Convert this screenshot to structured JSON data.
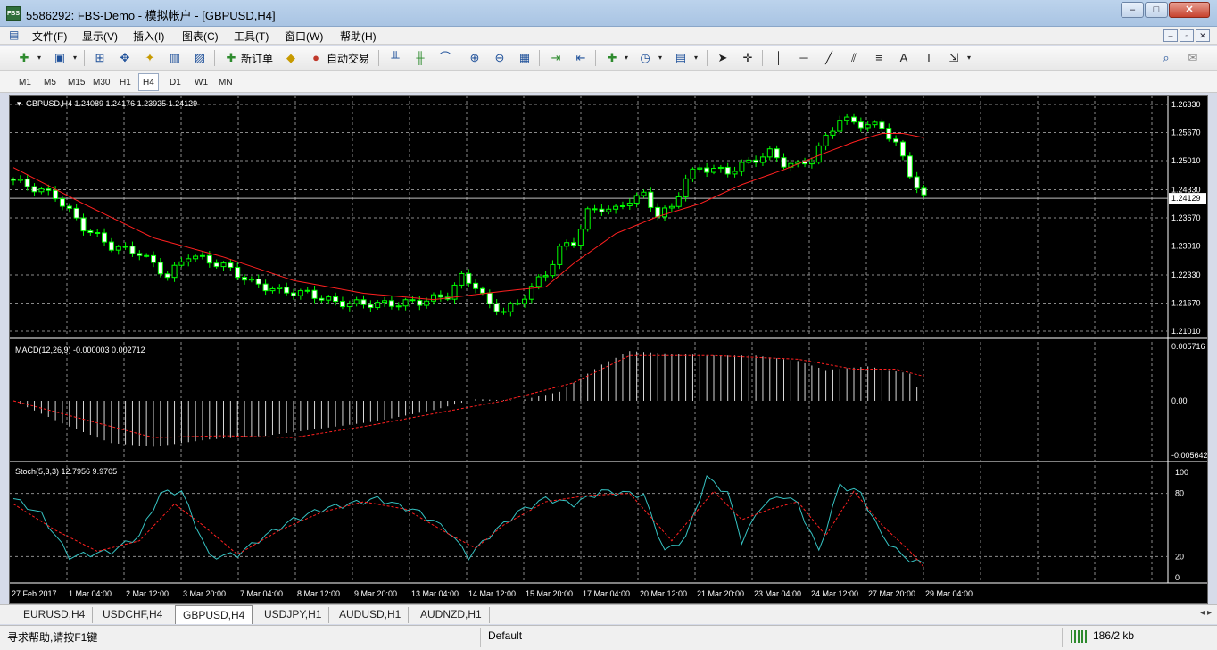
{
  "window": {
    "logo_text": "FBS",
    "title": "5586292: FBS-Demo - 模拟帐户 - [GBPUSD,H4]",
    "min_label": "–",
    "max_label": "□",
    "close_label": "✕"
  },
  "menu": {
    "items": [
      "文件(F)",
      "显示(V)",
      "插入(I)",
      "图表(C)",
      "工具(T)",
      "窗口(W)",
      "帮助(H)"
    ],
    "mdi": [
      "–",
      "▫",
      "✕"
    ]
  },
  "toolbar": {
    "new_order_label": "新订单",
    "autotrade_label": "自动交易"
  },
  "timeframes": {
    "items": [
      "M1",
      "M5",
      "M15",
      "M30",
      "H1",
      "H4",
      "D1",
      "W1",
      "MN"
    ],
    "active": "H4"
  },
  "chart": {
    "header": "GBPUSD,H4  1.24089 1.24176 1.23925 1.24129",
    "macd_label": "MACD(12,26,9) -0.000003 0.002712",
    "stoch_label": "Stoch(5,3,3) 12.7956 9.9705",
    "colors": {
      "background": "#000000",
      "grid": "#8a8a8a",
      "bull_candle": "#00ff00",
      "bear_candle": "#ffffff",
      "moving_average": "#ff2020",
      "stoch_main": "#36c3c3",
      "stoch_signal": "#ff2020",
      "macd_histogram": "#d8d8d8",
      "macd_signal": "#ff2020",
      "axis_text": "#ffffff"
    },
    "price_axis": [
      "1.26330",
      "1.25670",
      "1.25010",
      "1.24330",
      "1.23670",
      "1.23010",
      "1.22330",
      "1.21670",
      "1.21010"
    ],
    "current_price": "1.24129",
    "macd_axis": [
      "0.005716",
      "0.00",
      "-0.005642"
    ],
    "stoch_axis": [
      "100",
      "80",
      "20",
      "0"
    ],
    "time_axis": [
      "27 Feb 2017",
      "1 Mar 04:00",
      "2 Mar 12:00",
      "3 Mar 20:00",
      "7 Mar 04:00",
      "8 Mar 12:00",
      "9 Mar 20:00",
      "13 Mar 04:00",
      "14 Mar 12:00",
      "15 Mar 20:00",
      "17 Mar 04:00",
      "20 Mar 12:00",
      "21 Mar 20:00",
      "23 Mar 04:00",
      "24 Mar 12:00",
      "27 Mar 20:00",
      "29 Mar 04:00"
    ]
  },
  "chart_data": {
    "type": "candlestick",
    "symbol": "GBPUSD",
    "timeframe": "H4",
    "ylim": [
      1.2101,
      1.2633
    ],
    "close_path": [
      [
        0,
        1.2455
      ],
      [
        6,
        1.2418
      ],
      [
        10,
        1.2345
      ],
      [
        14,
        1.23
      ],
      [
        18,
        1.2285
      ],
      [
        22,
        1.223
      ],
      [
        25,
        1.228
      ],
      [
        30,
        1.2255
      ],
      [
        34,
        1.2215
      ],
      [
        38,
        1.2195
      ],
      [
        42,
        1.219
      ],
      [
        46,
        1.2168
      ],
      [
        50,
        1.2165
      ],
      [
        54,
        1.2165
      ],
      [
        58,
        1.217
      ],
      [
        62,
        1.2185
      ],
      [
        64,
        1.2228
      ],
      [
        66,
        1.2208
      ],
      [
        68,
        1.216
      ],
      [
        70,
        1.215
      ],
      [
        72,
        1.2165
      ],
      [
        74,
        1.2205
      ],
      [
        76,
        1.2235
      ],
      [
        78,
        1.2295
      ],
      [
        80,
        1.231
      ],
      [
        82,
        1.238
      ],
      [
        84,
        1.239
      ],
      [
        86,
        1.2385
      ],
      [
        88,
        1.241
      ],
      [
        90,
        1.242
      ],
      [
        92,
        1.2375
      ],
      [
        94,
        1.239
      ],
      [
        96,
        1.246
      ],
      [
        98,
        1.2485
      ],
      [
        100,
        1.248
      ],
      [
        102,
        1.2475
      ],
      [
        104,
        1.249
      ],
      [
        106,
        1.2505
      ],
      [
        108,
        1.252
      ],
      [
        110,
        1.2495
      ],
      [
        112,
        1.249
      ],
      [
        114,
        1.2505
      ],
      [
        116,
        1.2555
      ],
      [
        118,
        1.26
      ],
      [
        120,
        1.259
      ],
      [
        122,
        1.2585
      ],
      [
        124,
        1.258
      ],
      [
        126,
        1.254
      ],
      [
        128,
        1.247
      ],
      [
        130,
        1.2413
      ]
    ],
    "ma_path": [
      [
        0,
        1.2485
      ],
      [
        10,
        1.24
      ],
      [
        20,
        1.232
      ],
      [
        30,
        1.2275
      ],
      [
        40,
        1.222
      ],
      [
        50,
        1.219
      ],
      [
        60,
        1.2175
      ],
      [
        70,
        1.2195
      ],
      [
        76,
        1.2205
      ],
      [
        80,
        1.226
      ],
      [
        86,
        1.233
      ],
      [
        92,
        1.237
      ],
      [
        98,
        1.24
      ],
      [
        104,
        1.2445
      ],
      [
        110,
        1.248
      ],
      [
        116,
        1.252
      ],
      [
        120,
        1.2545
      ],
      [
        124,
        1.2565
      ],
      [
        127,
        1.2565
      ],
      [
        130,
        1.2555
      ]
    ],
    "macd_range": [
      -0.005642,
      0.005716
    ],
    "macd_path": [
      [
        0,
        0.0
      ],
      [
        8,
        -0.0028
      ],
      [
        14,
        -0.0046
      ],
      [
        20,
        -0.005
      ],
      [
        28,
        -0.0042
      ],
      [
        36,
        -0.0038
      ],
      [
        44,
        -0.003
      ],
      [
        52,
        -0.0022
      ],
      [
        60,
        -0.001
      ],
      [
        66,
        0.0002
      ],
      [
        72,
        0.0
      ],
      [
        78,
        0.001
      ],
      [
        84,
        0.004
      ],
      [
        88,
        0.0055
      ],
      [
        94,
        0.0052
      ],
      [
        100,
        0.005
      ],
      [
        106,
        0.005
      ],
      [
        112,
        0.0044
      ],
      [
        116,
        0.0034
      ],
      [
        122,
        0.0038
      ],
      [
        128,
        0.003
      ],
      [
        130,
        -3e-06
      ]
    ],
    "macd_signal_path": [
      [
        0,
        0.0
      ],
      [
        10,
        -0.002
      ],
      [
        20,
        -0.004
      ],
      [
        30,
        -0.0038
      ],
      [
        40,
        -0.004
      ],
      [
        50,
        -0.0028
      ],
      [
        60,
        -0.0014
      ],
      [
        70,
        0.0
      ],
      [
        80,
        0.002
      ],
      [
        88,
        0.005
      ],
      [
        100,
        0.005
      ],
      [
        112,
        0.0046
      ],
      [
        120,
        0.0035
      ],
      [
        126,
        0.0035
      ],
      [
        130,
        0.0027
      ]
    ],
    "stoch_main_path": [
      [
        0,
        75
      ],
      [
        4,
        60
      ],
      [
        8,
        20
      ],
      [
        14,
        25
      ],
      [
        18,
        40
      ],
      [
        21,
        80
      ],
      [
        24,
        82
      ],
      [
        28,
        20
      ],
      [
        32,
        22
      ],
      [
        36,
        40
      ],
      [
        40,
        55
      ],
      [
        44,
        65
      ],
      [
        48,
        70
      ],
      [
        52,
        75
      ],
      [
        58,
        62
      ],
      [
        62,
        45
      ],
      [
        65,
        20
      ],
      [
        68,
        40
      ],
      [
        72,
        62
      ],
      [
        76,
        75
      ],
      [
        80,
        70
      ],
      [
        84,
        82
      ],
      [
        88,
        80
      ],
      [
        90,
        78
      ],
      [
        93,
        25
      ],
      [
        96,
        38
      ],
      [
        99,
        95
      ],
      [
        102,
        80
      ],
      [
        104,
        35
      ],
      [
        107,
        70
      ],
      [
        110,
        78
      ],
      [
        112,
        70
      ],
      [
        115,
        25
      ],
      [
        118,
        88
      ],
      [
        121,
        80
      ],
      [
        124,
        40
      ],
      [
        127,
        20
      ],
      [
        130,
        12.7956
      ]
    ],
    "stoch_signal_path": [
      [
        0,
        70
      ],
      [
        6,
        45
      ],
      [
        12,
        25
      ],
      [
        18,
        35
      ],
      [
        23,
        70
      ],
      [
        27,
        50
      ],
      [
        32,
        22
      ],
      [
        38,
        45
      ],
      [
        44,
        62
      ],
      [
        50,
        72
      ],
      [
        56,
        65
      ],
      [
        62,
        42
      ],
      [
        66,
        28
      ],
      [
        70,
        50
      ],
      [
        76,
        72
      ],
      [
        82,
        78
      ],
      [
        88,
        80
      ],
      [
        94,
        35
      ],
      [
        100,
        82
      ],
      [
        104,
        55
      ],
      [
        108,
        65
      ],
      [
        112,
        72
      ],
      [
        116,
        40
      ],
      [
        120,
        82
      ],
      [
        124,
        50
      ],
      [
        128,
        25
      ],
      [
        130,
        9.9705
      ]
    ]
  },
  "tabs": {
    "items": [
      "EURUSD,H4",
      "USDCHF,H4",
      "GBPUSD,H4",
      "USDJPY,H1",
      "AUDUSD,H1",
      "AUDNZD,H1"
    ],
    "active": "GBPUSD,H4",
    "scroll": "◂ ▸"
  },
  "status": {
    "help": "寻求帮助,请按F1键",
    "profile": "Default",
    "connection": "186/2 kb"
  }
}
